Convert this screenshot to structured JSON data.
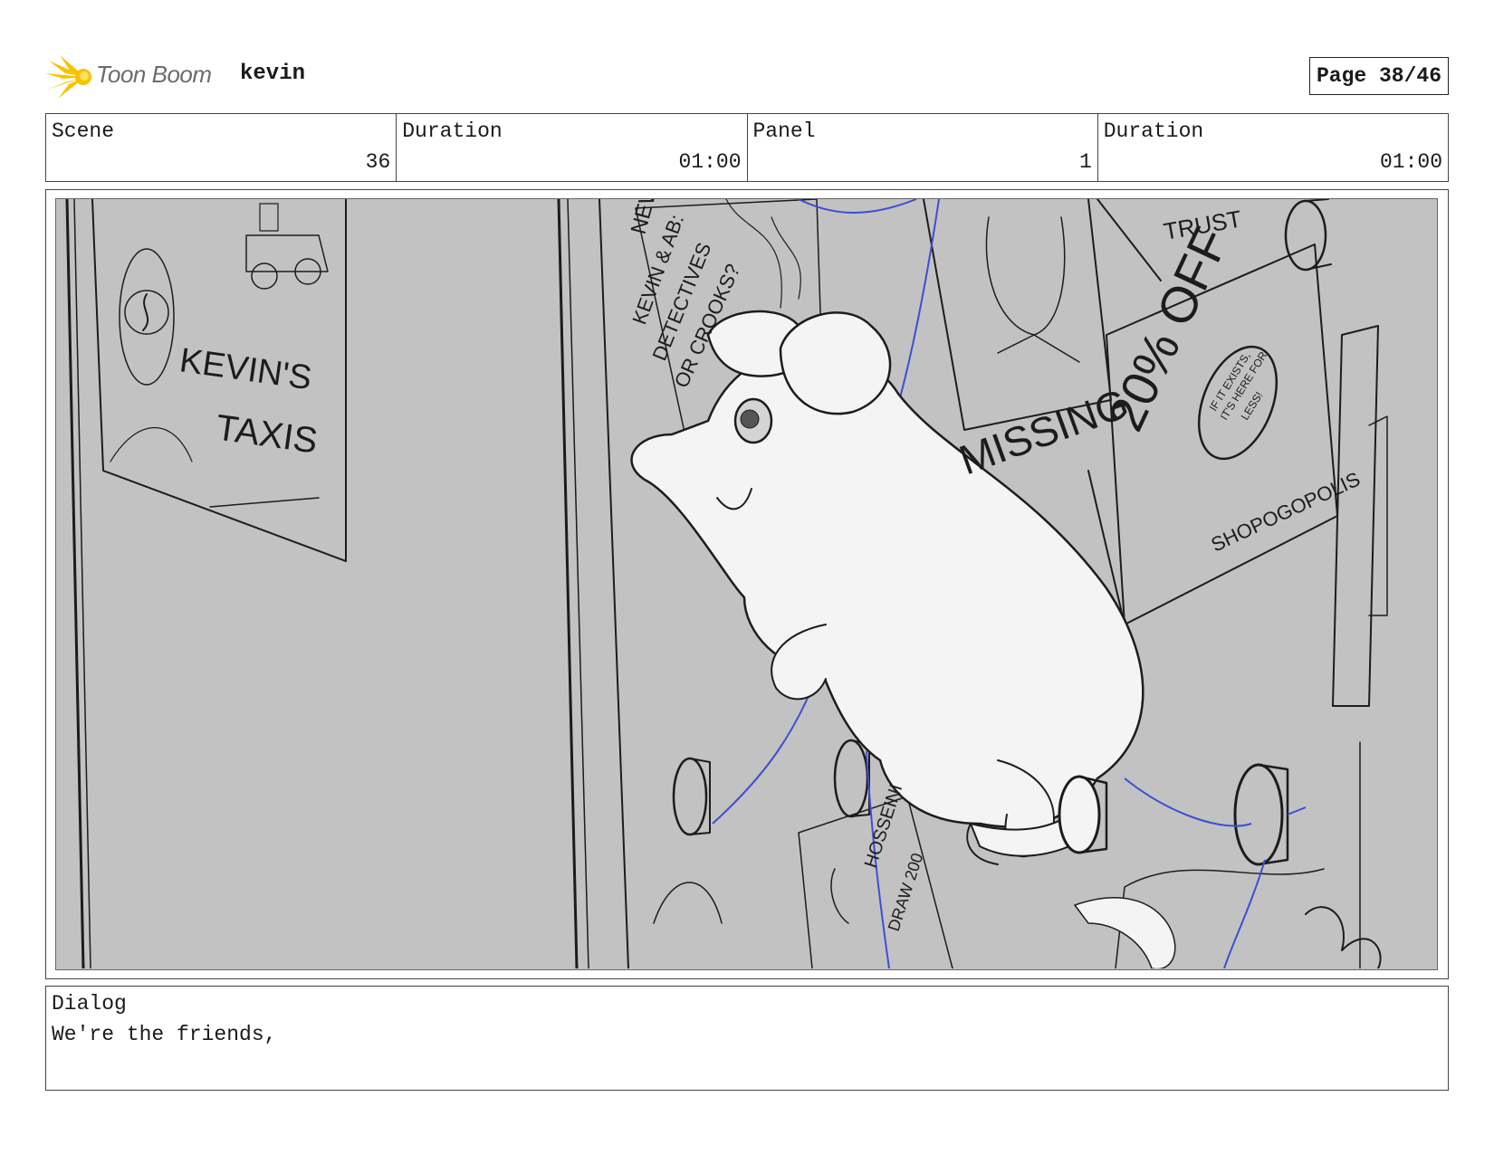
{
  "header": {
    "brand": "Toon Boom",
    "project": "kevin",
    "page": "Page 38/46"
  },
  "info": {
    "scene_label": "Scene",
    "scene_value": "36",
    "scene_duration_label": "Duration",
    "scene_duration_value": "01:00",
    "panel_label": "Panel",
    "panel_value": "1",
    "panel_duration_label": "Duration",
    "panel_duration_value": "01:00"
  },
  "panel": {
    "signs": {
      "poster_left_1": "KEVIN'S",
      "poster_left_2": "TAXIS",
      "news_1": "NEW",
      "news_2": "KEVIN & AB:",
      "news_3": "DETECTIVES",
      "news_4": "OR CROOKS?",
      "missing": "MISSING",
      "sale_1": "20% OFF",
      "sale_2": "IF IT EXISTS,",
      "sale_3": "IT'S HERE FOR",
      "sale_4": "LESS!",
      "sale_5": "SHOPOGOPOLIS",
      "trust": "TRUST",
      "hosseini_1": "HOSSEINI",
      "hosseini_2": "DRAW 200"
    },
    "colors": {
      "background": "#c2c2c2",
      "string": "#3b4fd4"
    }
  },
  "dialog": {
    "label": "Dialog",
    "text": "We're the friends,"
  }
}
